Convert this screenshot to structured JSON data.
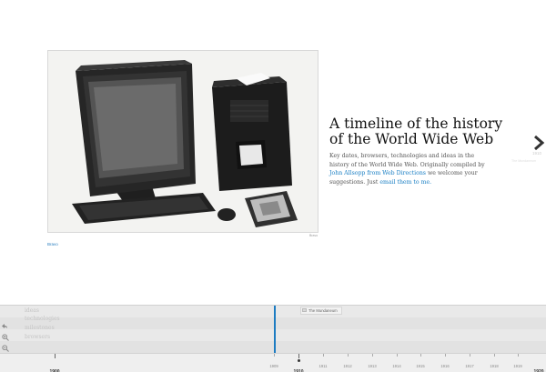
{
  "photo": {
    "caption": "Bravo",
    "credit": "Bravo"
  },
  "intro": {
    "title": "A timeline of the history of the World Wide Web",
    "desc_part1": "Key dates, browsers, technologies and ideas in the history of the World Wide Web. Originally compiled by ",
    "link_author": "John Allsopp from Web Directions",
    "desc_part2": " we welcome your suggestions. Just ",
    "link_email": "email them to me."
  },
  "next": {
    "year": "1910",
    "label": "The Mundaneum"
  },
  "timeline": {
    "bands": [
      "ideas",
      "technologies",
      "milestones",
      "browsers"
    ],
    "event": "The Mundaneum",
    "ruler": {
      "major_left": "1900",
      "current": "1909",
      "selected": "1910",
      "years": [
        "1911",
        "1912",
        "1913",
        "1914",
        "1915",
        "1916",
        "1917",
        "1918",
        "1919"
      ],
      "major_right": "1920"
    }
  }
}
